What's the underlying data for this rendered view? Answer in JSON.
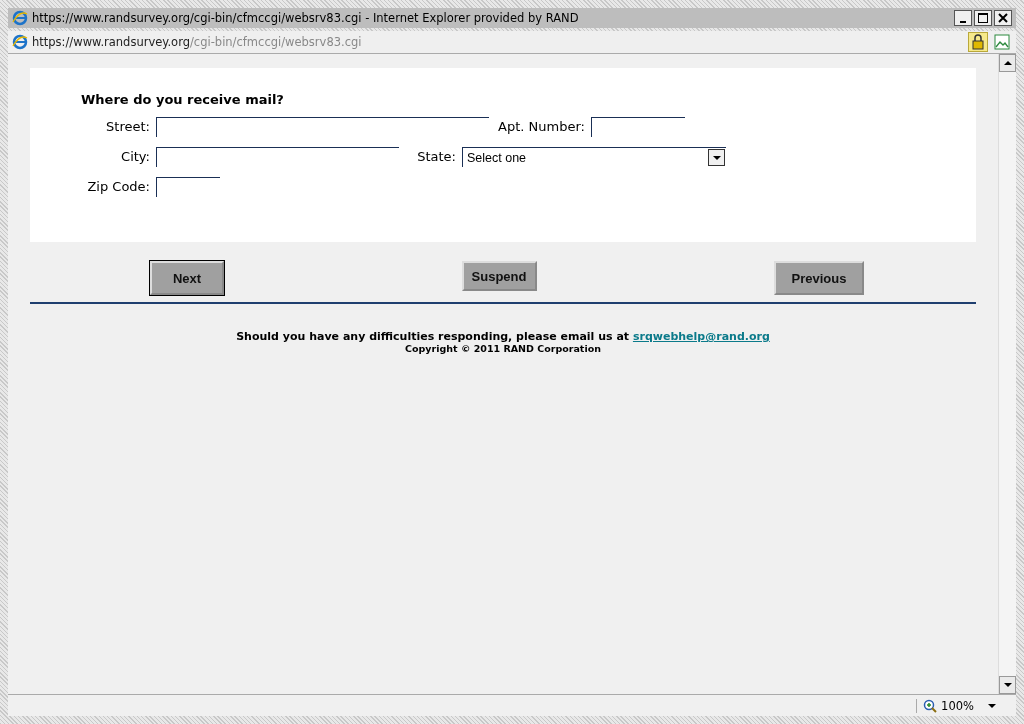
{
  "window": {
    "title": "https://www.randsurvey.org/cgi-bin/cfmccgi/websrv83.cgi - Internet Explorer provided by RAND"
  },
  "address_bar": {
    "host": "https://www.randsurvey.org",
    "path": "/cgi-bin/cfmccgi/websrv83.cgi"
  },
  "form": {
    "heading": "Where do you receive mail?",
    "rows": [
      {
        "fields": [
          {
            "label": "Street:",
            "kind": "text"
          },
          {
            "label": "Apt. Number:",
            "kind": "text"
          }
        ]
      },
      {
        "fields": [
          {
            "label": "City:",
            "kind": "text"
          },
          {
            "label": "State:",
            "kind": "select",
            "value": "Select one"
          }
        ]
      },
      {
        "fields": [
          {
            "label": "Zip Code:",
            "kind": "text"
          }
        ]
      }
    ]
  },
  "buttons": [
    {
      "label": "Next",
      "focused": true
    },
    {
      "label": "Suspend",
      "focused": false
    },
    {
      "label": "Previous",
      "focused": false
    }
  ],
  "footer": {
    "text": "Should you have any difficulties responding, please email us at",
    "email": "srqwebhelp@rand.org",
    "copyright": "Copyright © 2011 RAND Corporation"
  },
  "status_bar": {
    "zoom": "100%"
  }
}
